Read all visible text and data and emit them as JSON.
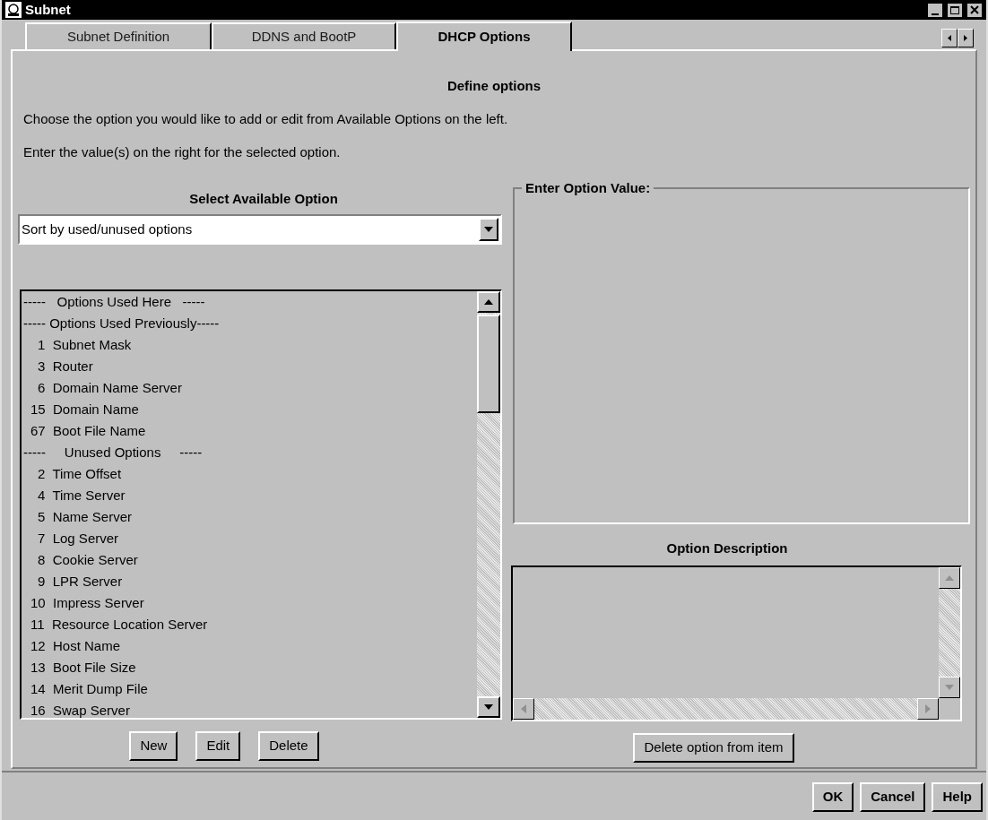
{
  "window": {
    "title": "Subnet"
  },
  "tabs": [
    {
      "label": "Subnet Definition",
      "selected": false
    },
    {
      "label": "DDNS and BootP",
      "selected": false
    },
    {
      "label": "DHCP Options",
      "selected": true
    }
  ],
  "heading": "Define options",
  "instructions": [
    "Choose the option you would like to add or edit from Available Options on the left.",
    "Enter the value(s) on the right for the selected option."
  ],
  "available": {
    "title": "Select Available Option",
    "sort": {
      "value": "Sort by used/unused options"
    },
    "items": [
      {
        "kind": "header",
        "label": "-----   Options Used Here   -----"
      },
      {
        "kind": "header",
        "label": "----- Options Used Previously-----"
      },
      {
        "kind": "option",
        "number": "1",
        "label": "Subnet Mask"
      },
      {
        "kind": "option",
        "number": "3",
        "label": "Router"
      },
      {
        "kind": "option",
        "number": "6",
        "label": "Domain Name Server"
      },
      {
        "kind": "option",
        "number": "15",
        "label": "Domain Name"
      },
      {
        "kind": "option",
        "number": "67",
        "label": "Boot File Name"
      },
      {
        "kind": "header",
        "label": "-----     Unused Options     -----"
      },
      {
        "kind": "option",
        "number": "2",
        "label": "Time Offset"
      },
      {
        "kind": "option",
        "number": "4",
        "label": "Time Server"
      },
      {
        "kind": "option",
        "number": "5",
        "label": "Name Server"
      },
      {
        "kind": "option",
        "number": "7",
        "label": "Log Server"
      },
      {
        "kind": "option",
        "number": "8",
        "label": "Cookie Server"
      },
      {
        "kind": "option",
        "number": "9",
        "label": "LPR Server"
      },
      {
        "kind": "option",
        "number": "10",
        "label": "Impress Server"
      },
      {
        "kind": "option",
        "number": "11",
        "label": "Resource Location Server"
      },
      {
        "kind": "option",
        "number": "12",
        "label": "Host Name"
      },
      {
        "kind": "option",
        "number": "13",
        "label": "Boot File Size"
      },
      {
        "kind": "option",
        "number": "14",
        "label": "Merit Dump File"
      },
      {
        "kind": "option",
        "number": "16",
        "label": "Swap Server"
      }
    ],
    "buttons": [
      "New",
      "Edit",
      "Delete"
    ]
  },
  "value_group": {
    "title": "Enter Option Value:"
  },
  "description": {
    "title": "Option Description",
    "button": "Delete option from item"
  },
  "footer_buttons": [
    "OK",
    "Cancel",
    "Help"
  ]
}
